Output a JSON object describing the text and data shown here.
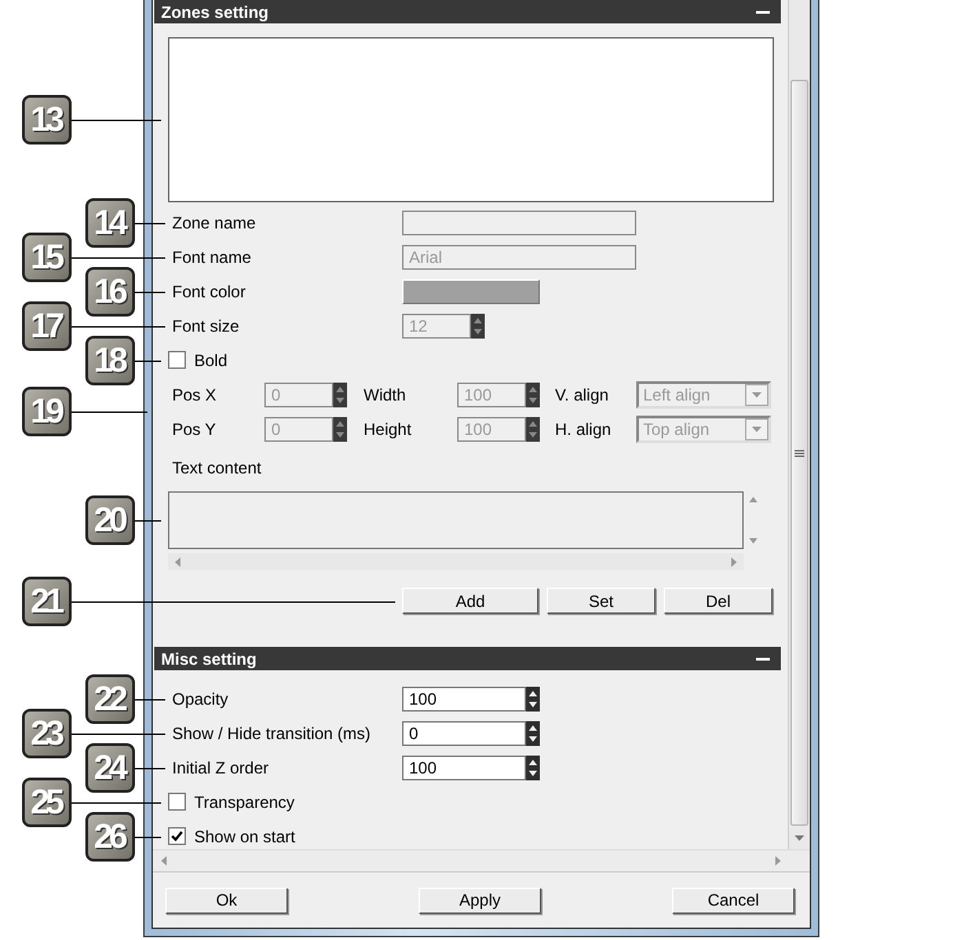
{
  "zones": {
    "title": "Zones setting",
    "list_callout": "13",
    "rows": [
      {
        "kind": "text",
        "label": "Zone name",
        "disabled": true,
        "callout": "14"
      },
      {
        "kind": "text",
        "label": "Font name",
        "value": "Arial",
        "disabled": true,
        "callout": "15"
      },
      {
        "kind": "color",
        "label": "Font color",
        "disabled": true,
        "callout": "16"
      },
      {
        "kind": "spin",
        "label": "Font size",
        "value": "12",
        "disabled": true,
        "callout": "17"
      },
      {
        "kind": "checkbox",
        "label": "Bold",
        "checked": false,
        "callout": "18"
      }
    ],
    "position": {
      "callout": "19",
      "rows": [
        [
          {
            "kind": "spin",
            "label": "Pos X",
            "value": "0",
            "disabled": true
          },
          {
            "kind": "spin",
            "label": "Width",
            "value": "100",
            "disabled": true
          },
          {
            "kind": "select",
            "label": "V. align",
            "value": "Left align",
            "disabled": true
          }
        ],
        [
          {
            "kind": "spin",
            "label": "Pos Y",
            "value": "0",
            "disabled": true
          },
          {
            "kind": "spin",
            "label": "Height",
            "value": "100",
            "disabled": true
          },
          {
            "kind": "select",
            "label": "H. align",
            "value": "Top align",
            "disabled": true
          }
        ]
      ]
    },
    "text_content": {
      "label": "Text content",
      "callout": "20"
    },
    "actions": {
      "callout": "21",
      "buttons": [
        "Add",
        "Set",
        "Del"
      ]
    }
  },
  "misc": {
    "title": "Misc setting",
    "rows": [
      {
        "kind": "spin",
        "label": "Opacity",
        "value": "100",
        "disabled": false,
        "callout": "22"
      },
      {
        "kind": "spin",
        "label": "Show / Hide transition (ms)",
        "value": "0",
        "disabled": false,
        "callout": "23"
      },
      {
        "kind": "spin",
        "label": "Initial Z order",
        "value": "100",
        "disabled": false,
        "callout": "24"
      },
      {
        "kind": "checkbox",
        "label": "Transparency",
        "checked": false,
        "callout": "25"
      },
      {
        "kind": "checkbox",
        "label": "Show on start",
        "checked": true,
        "callout": "26"
      }
    ]
  },
  "footer_buttons": [
    "Ok",
    "Apply",
    "Cancel"
  ]
}
